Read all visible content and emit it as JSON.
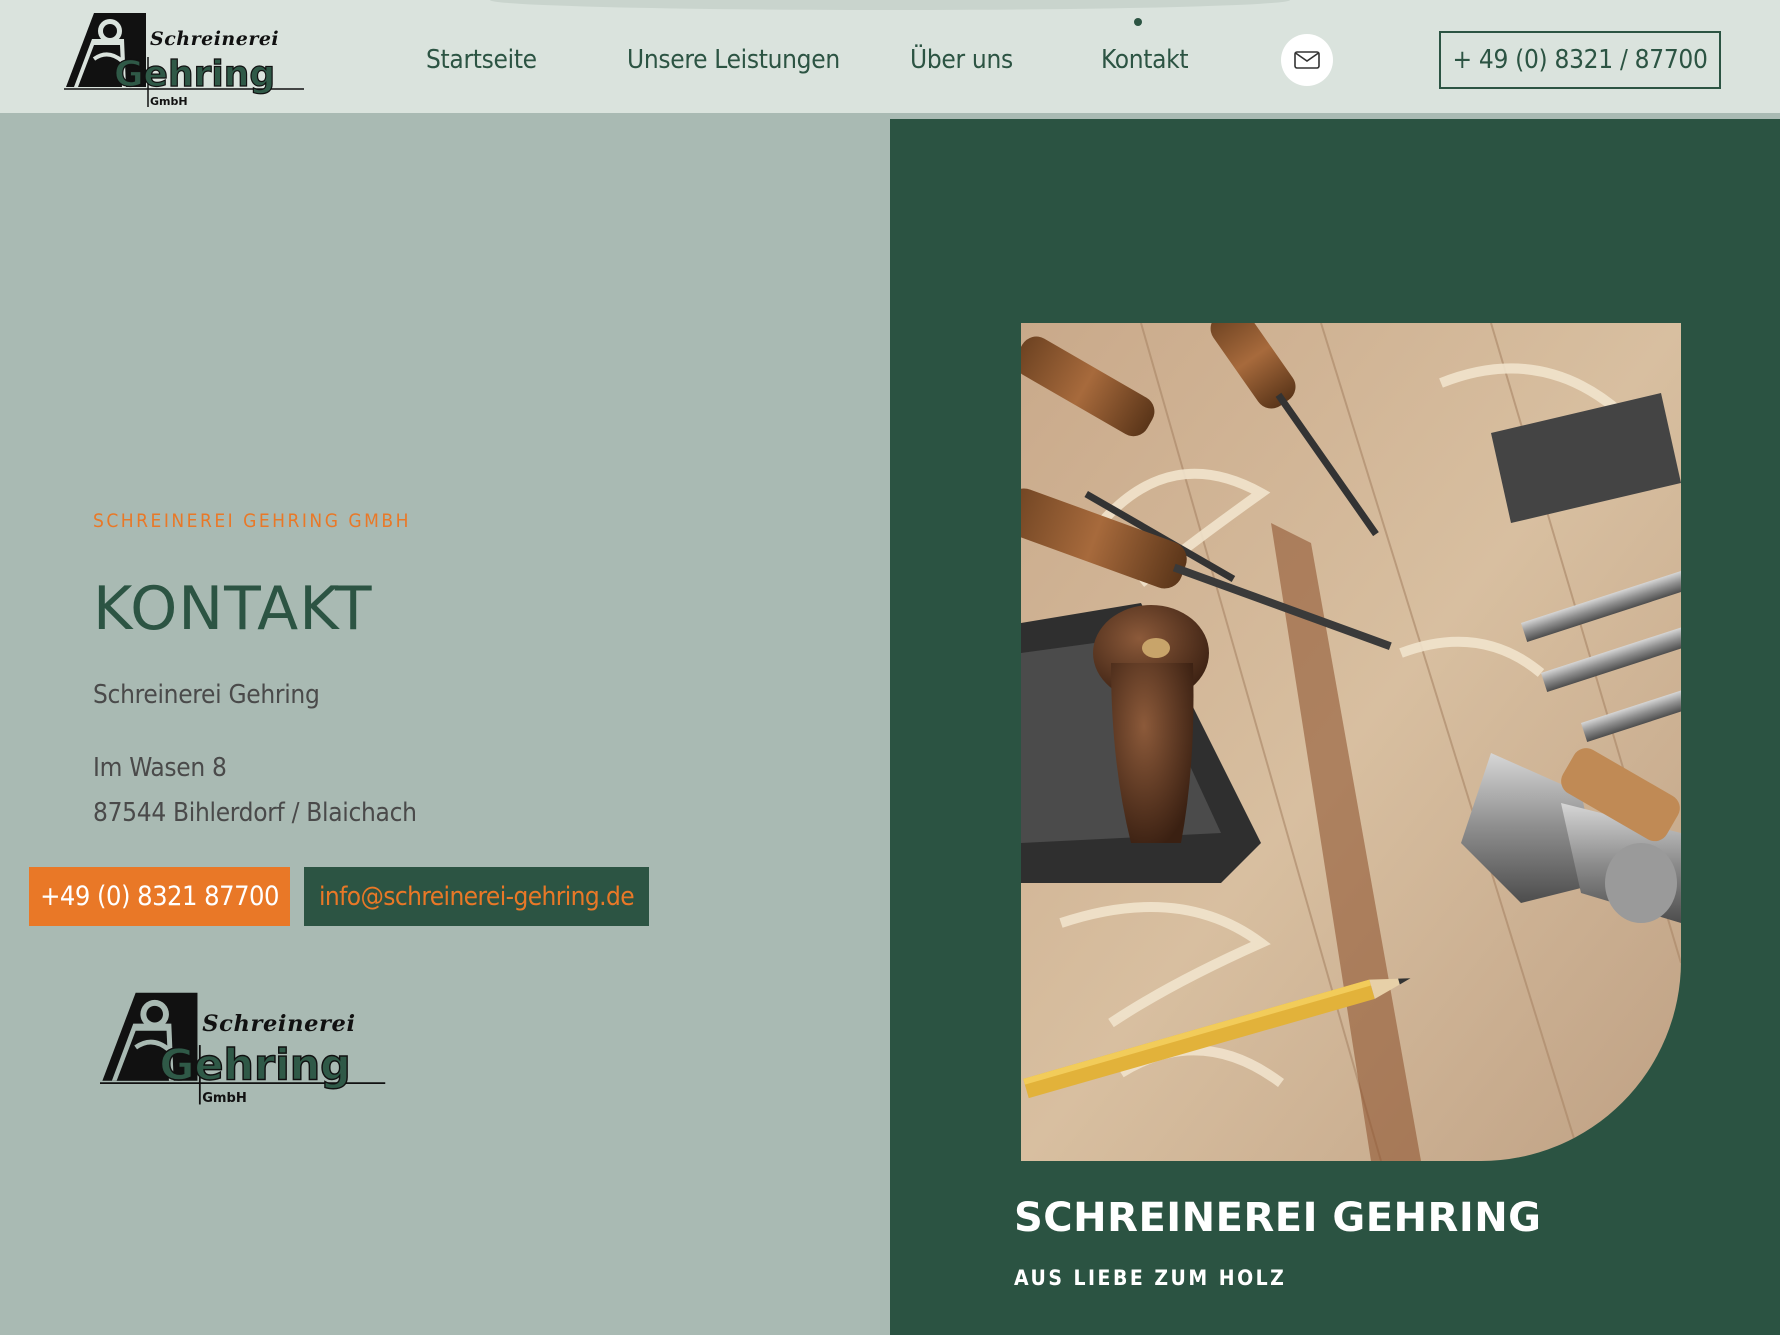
{
  "brand": {
    "logo_top": "Schreinerei",
    "logo_main": "Gehring",
    "logo_sub": "GmbH"
  },
  "nav": {
    "items": [
      {
        "label": "Startseite"
      },
      {
        "label": "Unsere Leistungen"
      },
      {
        "label": "Über uns"
      },
      {
        "label": "Kontakt",
        "active": true
      }
    ],
    "mail_icon": "envelope-icon",
    "phone_label": "+ 49 (0) 8321 / 87700"
  },
  "contact": {
    "eyebrow": "SCHREINEREI GEHRING GMBH",
    "title": "KONTAKT",
    "company": "Schreinerei Gehring",
    "street": "Im Wasen 8",
    "city": "87544 Bihlerdorf / Blaichach",
    "phone_button": "+49 (0) 8321 87700",
    "email_button": "info@schreinerei-gehring.de"
  },
  "hero": {
    "heading": "SCHREINEREI GEHRING",
    "tagline": "AUS LIEBE ZUM HOLZ"
  },
  "colors": {
    "dark_green": "#2b5342",
    "sage": "#a9bab3",
    "header_bg": "#dae3dd",
    "orange": "#e97827"
  }
}
